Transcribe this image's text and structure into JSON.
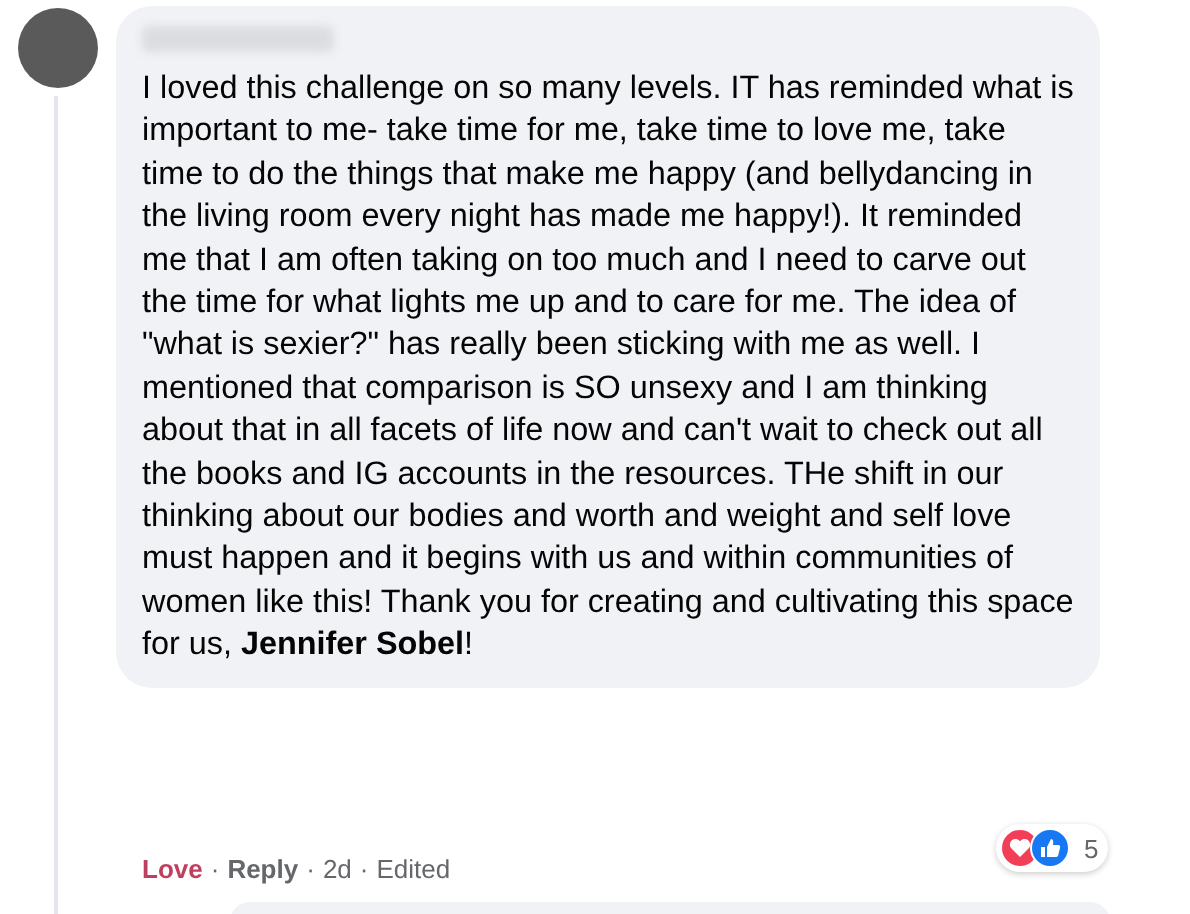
{
  "comment": {
    "text": "I loved this challenge on so many levels. IT has reminded what is important to me- take time for me, take time to love me, take time to do the things that make me happy (and bellydancing in the living room every night has made me happy!). It reminded me that I am often taking on too much and I need to carve out the time for what lights me up and to care for me. The idea of \"what is sexier?\" has really been sticking with me as well. I mentioned that comparison is SO unsexy and I am thinking about that in all facets of life now and can't wait to check out all the books and IG accounts in the resources. THe shift in our thinking about our bodies and worth and weight and self love must happen and it begins with us and within communities of women like this! Thank you for creating and cultivating this space for us, **Jennifer Sobel**!",
    "actions": [
      {
        "label": "Love",
        "selected": true
      },
      {
        "label": "Reply",
        "selected": false
      }
    ],
    "separator": "·",
    "time": "2d",
    "edited": "Edited",
    "reactions": {
      "count": "5"
    }
  }
}
